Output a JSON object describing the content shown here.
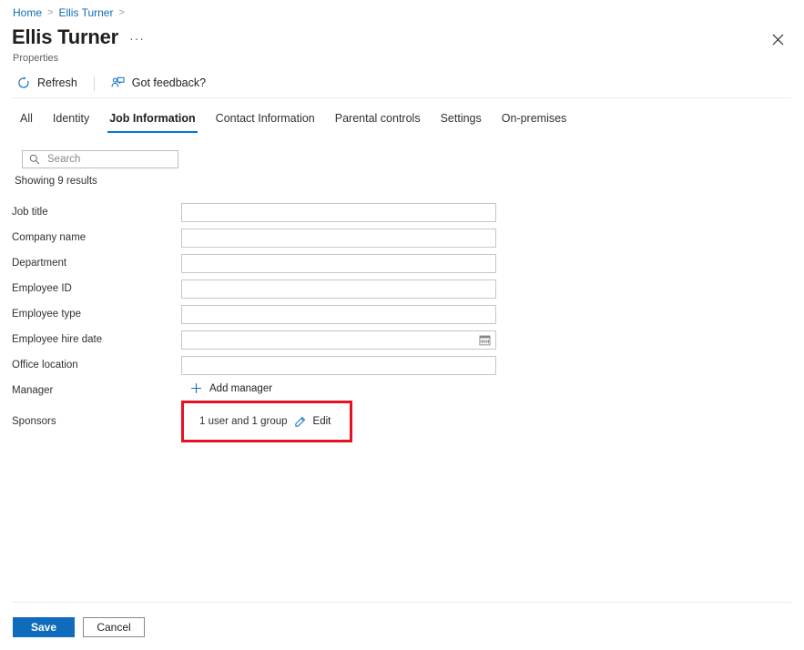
{
  "breadcrumb": {
    "items": [
      {
        "label": "Home"
      },
      {
        "label": "Ellis Turner"
      }
    ],
    "separator": ">"
  },
  "header": {
    "title": "Ellis Turner",
    "subtitle": "Properties",
    "more_label": "···",
    "close_icon": "close-icon"
  },
  "commandbar": {
    "refresh_label": "Refresh",
    "refresh_icon": "refresh-icon",
    "feedback_label": "Got feedback?",
    "feedback_icon": "feedback-person-icon"
  },
  "tabs": [
    {
      "label": "All",
      "selected": false
    },
    {
      "label": "Identity",
      "selected": false
    },
    {
      "label": "Job Information",
      "selected": true
    },
    {
      "label": "Contact Information",
      "selected": false
    },
    {
      "label": "Parental controls",
      "selected": false
    },
    {
      "label": "Settings",
      "selected": false
    },
    {
      "label": "On-premises",
      "selected": false
    }
  ],
  "search": {
    "placeholder": "Search",
    "value": "",
    "icon": "search-icon"
  },
  "results": {
    "text": "Showing 9 results"
  },
  "fields": [
    {
      "label": "Job title",
      "value": "",
      "type": "text"
    },
    {
      "label": "Company name",
      "value": "",
      "type": "text"
    },
    {
      "label": "Department",
      "value": "",
      "type": "text"
    },
    {
      "label": "Employee ID",
      "value": "",
      "type": "text"
    },
    {
      "label": "Employee type",
      "value": "",
      "type": "text"
    },
    {
      "label": "Employee hire date",
      "value": "",
      "type": "date"
    },
    {
      "label": "Office location",
      "value": "",
      "type": "text"
    }
  ],
  "manager": {
    "label": "Manager",
    "action_label": "Add manager",
    "action_icon": "plus-icon"
  },
  "sponsors": {
    "label": "Sponsors",
    "summary": "1 user and 1 group",
    "edit_label": "Edit",
    "edit_icon": "pencil-icon",
    "highlight_color": "#e81123"
  },
  "footer": {
    "save_label": "Save",
    "cancel_label": "Cancel"
  },
  "colors": {
    "accent": "#0f6cbd",
    "tab_underline": "#0078d4",
    "highlight": "#e81123"
  }
}
